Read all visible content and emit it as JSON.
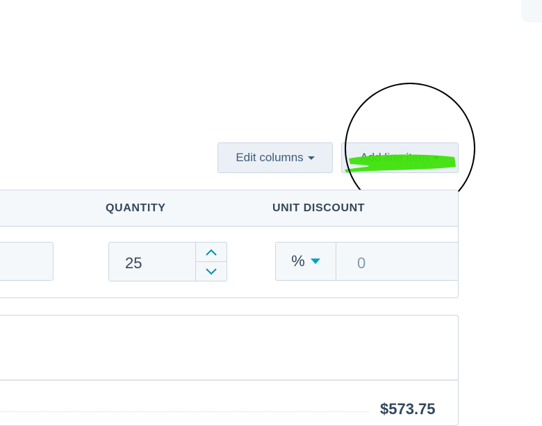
{
  "toolbar": {
    "edit_columns_label": "Edit columns",
    "add_line_item_label": "Add line item"
  },
  "table": {
    "columns": [
      "QUANTITY",
      "UNIT DISCOUNT"
    ],
    "row": {
      "quantity": "25",
      "discount_unit": "%",
      "discount_value": "0"
    }
  },
  "summary": {
    "total": "$573.75"
  },
  "colors": {
    "highlight": "#3ee10a",
    "accent": "#00a4bd",
    "annotation_circle": "#000000"
  }
}
